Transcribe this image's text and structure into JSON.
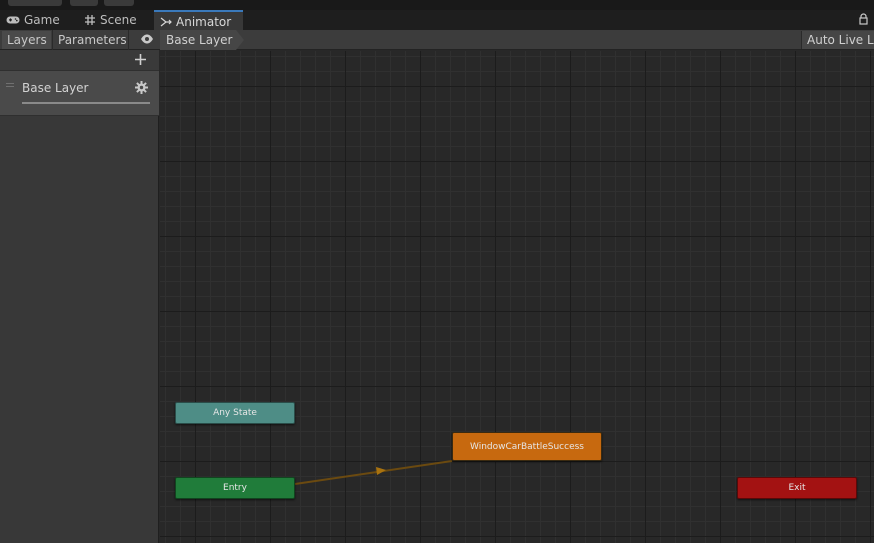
{
  "tabs": [
    {
      "name": "tab-game",
      "label": "Game",
      "icon": "gamepad-icon"
    },
    {
      "name": "tab-scene",
      "label": "Scene",
      "icon": "grid-icon"
    },
    {
      "name": "tab-animator",
      "label": "Animator",
      "icon": "animator-icon",
      "active": true
    }
  ],
  "toolbar": {
    "layers_label": "Layers",
    "parameters_label": "Parameters",
    "breadcrumb": "Base Layer",
    "auto_live_link": "Auto Live Lin"
  },
  "layers": [
    {
      "name": "Base Layer"
    }
  ],
  "graph": {
    "any_state": "Any State",
    "entry": "Entry",
    "default_state": "WindowCarBattleSuccess",
    "exit": "Exit"
  },
  "colors": {
    "accent": "#3a79bb",
    "any_state": "#4e8d86",
    "entry": "#207c3a",
    "default_state": "#c7690f",
    "exit": "#a31212",
    "transition": "#6b4a10"
  }
}
